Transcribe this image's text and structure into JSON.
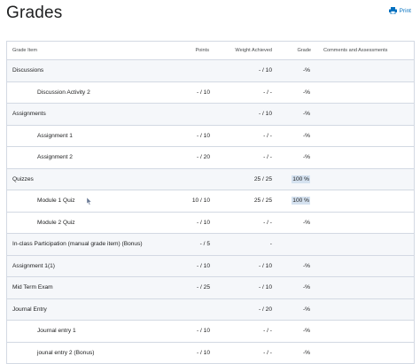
{
  "header": {
    "title": "Grades",
    "print_label": "Print"
  },
  "table": {
    "columns": {
      "grade_item": "Grade Item",
      "points": "Points",
      "weight_achieved": "Weight Achieved",
      "grade": "Grade",
      "comments": "Comments and Assessments"
    },
    "rows": [
      {
        "name": "Discussions",
        "points": "",
        "weight": "- / 10",
        "grade": "-%"
      },
      {
        "name": "Discussion Activity 2",
        "points": "- / 10",
        "weight": "- / -",
        "grade": "-%"
      },
      {
        "name": "Assignments",
        "points": "",
        "weight": "- / 10",
        "grade": "-%"
      },
      {
        "name": "Assignment 1",
        "points": "- / 10",
        "weight": "- / -",
        "grade": "-%"
      },
      {
        "name": "Assignment 2",
        "points": "- / 20",
        "weight": "- / -",
        "grade": "-%"
      },
      {
        "name": "Quizzes",
        "points": "",
        "weight": "25 / 25",
        "grade": "100 %"
      },
      {
        "name": "Module 1 Quiz",
        "points": "10 / 10",
        "weight": "25 / 25",
        "grade": "100 %"
      },
      {
        "name": "Module 2 Quiz",
        "points": "- / 10",
        "weight": "- / -",
        "grade": "-%"
      },
      {
        "name": "In-class Participation (manual grade item) (Bonus)",
        "points": "- / 5",
        "weight": "-",
        "grade": ""
      },
      {
        "name": "Assignment 1(1)",
        "points": "- / 10",
        "weight": "- / 10",
        "grade": "-%"
      },
      {
        "name": "Mid Term Exam",
        "points": "- / 25",
        "weight": "- / 10",
        "grade": "-%"
      },
      {
        "name": "Journal Entry",
        "points": "",
        "weight": "- / 20",
        "grade": "-%"
      },
      {
        "name": "Journal entry 1",
        "points": "- / 10",
        "weight": "- / -",
        "grade": "-%"
      },
      {
        "name": "jounal entry 2 (Bonus)",
        "points": "- / 10",
        "weight": "- / -",
        "grade": "-%"
      }
    ]
  },
  "colors": {
    "link": "#006fbf",
    "category_bg": "#f5f7fa",
    "border": "#d3d9e3",
    "grade_highlight": "#d5e2f0"
  }
}
